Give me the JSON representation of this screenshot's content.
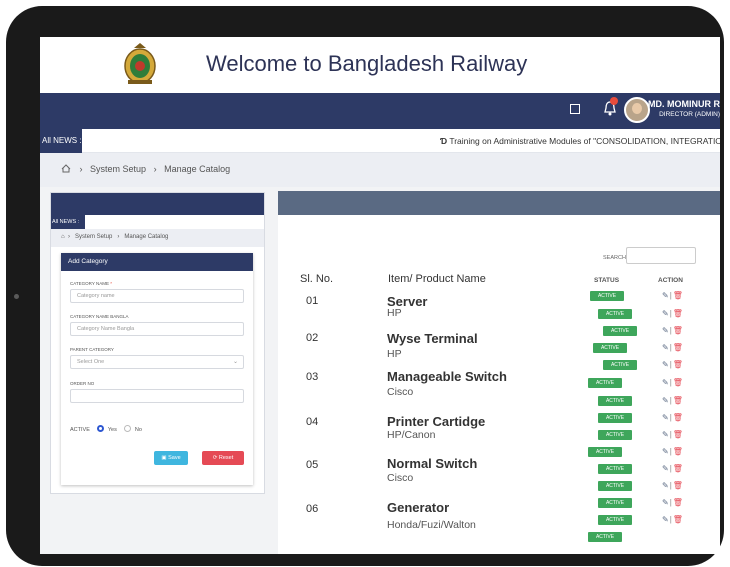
{
  "header": {
    "title": "Welcome to Bangladesh Railway"
  },
  "user": {
    "name": "MD. MOMINUR RASHID",
    "role": "DIRECTOR (ADMIN)",
    "notification_count": "0"
  },
  "news": {
    "label": "All NEWS :",
    "text": "Training on Administrative Modules of \"CONSOLIDATION, INTEGRATION AND UP-GRAD"
  },
  "breadcrumb": {
    "items": [
      "System Setup",
      "Manage Catalog"
    ]
  },
  "form": {
    "title": "Add Category",
    "category_name_label": "CATEGORY NAME",
    "category_name_placeholder": "Category name",
    "category_name_bangla_label": "CATEGORY NAME BANGLA",
    "category_name_bangla_placeholder": "Category Name Bangla",
    "parent_category_label": "PARENT CATEGORY",
    "parent_category_value": "Select One",
    "order_no_label": "ORDER NO",
    "active_label": "ACTIVE",
    "yes_label": "Yes",
    "no_label": "No",
    "save_label": "Save",
    "reset_label": "Reset"
  },
  "table": {
    "search_label": "SEARCH:",
    "headers": {
      "sl": "Sl. No.",
      "item": "Item/ Product Name",
      "status": "STATUS",
      "action": "ACTION"
    },
    "rows": [
      {
        "no": "01",
        "name": "Server",
        "sub": "HP"
      },
      {
        "no": "02",
        "name": "Wyse Terminal",
        "sub": "HP"
      },
      {
        "no": "03",
        "name": "Manageable Switch",
        "sub": "Cisco"
      },
      {
        "no": "04",
        "name": "Printer Cartidge",
        "sub": "HP/Canon"
      },
      {
        "no": "05",
        "name": "Normal Switch",
        "sub": "Cisco"
      },
      {
        "no": "06",
        "name": "Generator",
        "sub": "Honda/Fuzi/Walton"
      }
    ],
    "status_badge": "ACTIVE"
  },
  "colors": {
    "navy": "#2d3a66",
    "active_green": "#3ea65b",
    "save_blue": "#3fb6df",
    "reset_red": "#e54a55"
  }
}
